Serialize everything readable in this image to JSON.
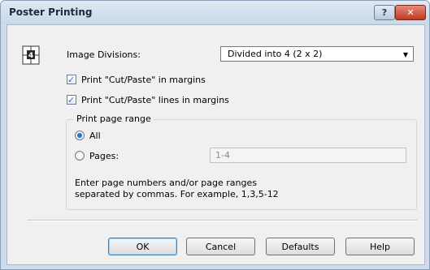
{
  "window": {
    "title": "Poster Printing"
  },
  "image_divisions": {
    "label": "Image Divisions:",
    "selected": "Divided into 4 (2 x 2)"
  },
  "options": {
    "cut_paste_margins": {
      "label": "Print \"Cut/Paste\" in margins",
      "checked": true
    },
    "cut_paste_lines": {
      "label": "Print \"Cut/Paste\" lines in margins",
      "checked": true
    }
  },
  "print_range": {
    "title": "Print page range",
    "all_label": "All",
    "pages_label": "Pages:",
    "pages_value": "1-4",
    "hint_line1": "Enter page numbers and/or page ranges",
    "hint_line2": "separated by commas. For example, 1,3,5-12"
  },
  "buttons": {
    "ok": "OK",
    "cancel": "Cancel",
    "defaults": "Defaults",
    "help": "Help"
  },
  "titlebar_buttons": {
    "help": "?",
    "close": "✕"
  },
  "icons": {
    "combo_arrow": "▼",
    "checkmark": "✓",
    "poster_number": "4"
  },
  "colors": {
    "accent": "#2b6fcf",
    "close": "#c03a24"
  }
}
